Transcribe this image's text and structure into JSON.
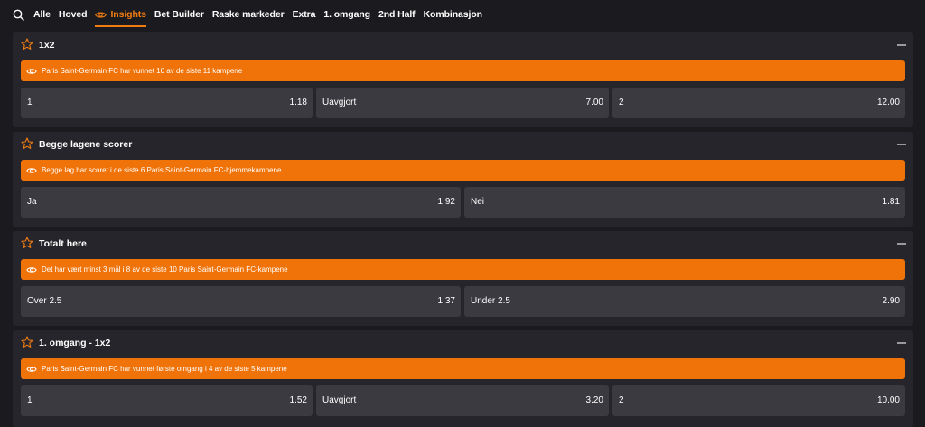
{
  "tabs": {
    "items": [
      {
        "label": "Alle"
      },
      {
        "label": "Hoved"
      },
      {
        "label": "Insights",
        "active": true
      },
      {
        "label": "Bet Builder"
      },
      {
        "label": "Raske markeder"
      },
      {
        "label": "Extra"
      },
      {
        "label": "1. omgang"
      },
      {
        "label": "2nd Half"
      },
      {
        "label": "Kombinasjon"
      }
    ]
  },
  "markets": [
    {
      "title": "1x2",
      "insight": "Paris Saint-Germain FC har vunnet 10 av de siste 11 kampene",
      "outcomes": [
        {
          "label": "1",
          "odds": "1.18"
        },
        {
          "label": "Uavgjort",
          "odds": "7.00"
        },
        {
          "label": "2",
          "odds": "12.00"
        }
      ]
    },
    {
      "title": "Begge lagene scorer",
      "insight": "Begge lag har scoret i de siste 6 Paris Saint-Germain FC-hjemmekampene",
      "outcomes": [
        {
          "label": "Ja",
          "odds": "1.92"
        },
        {
          "label": "Nei",
          "odds": "1.81"
        }
      ]
    },
    {
      "title": "Totalt here",
      "insight": "Det har vært minst 3 mål i 8 av de siste 10 Paris Saint-Germain FC-kampene",
      "outcomes": [
        {
          "label": "Over 2.5",
          "odds": "1.37"
        },
        {
          "label": "Under 2.5",
          "odds": "2.90"
        }
      ]
    },
    {
      "title": "1. omgang - 1x2",
      "insight": "Paris Saint-Germain FC har vunnet første omgang i 4 av de siste 5 kampene",
      "outcomes": [
        {
          "label": "1",
          "odds": "1.52"
        },
        {
          "label": "Uavgjort",
          "odds": "3.20"
        },
        {
          "label": "2",
          "odds": "10.00"
        }
      ]
    }
  ],
  "colors": {
    "accent": "#f07d12",
    "insight_bg": "#f07309",
    "card_bg": "#26252b",
    "odd_bg": "#3b3a41",
    "page_bg": "#1b1a1e"
  },
  "icons": {
    "search": "search-icon",
    "eye": "eye-icon",
    "star": "star-icon",
    "collapse": "minus-icon"
  }
}
